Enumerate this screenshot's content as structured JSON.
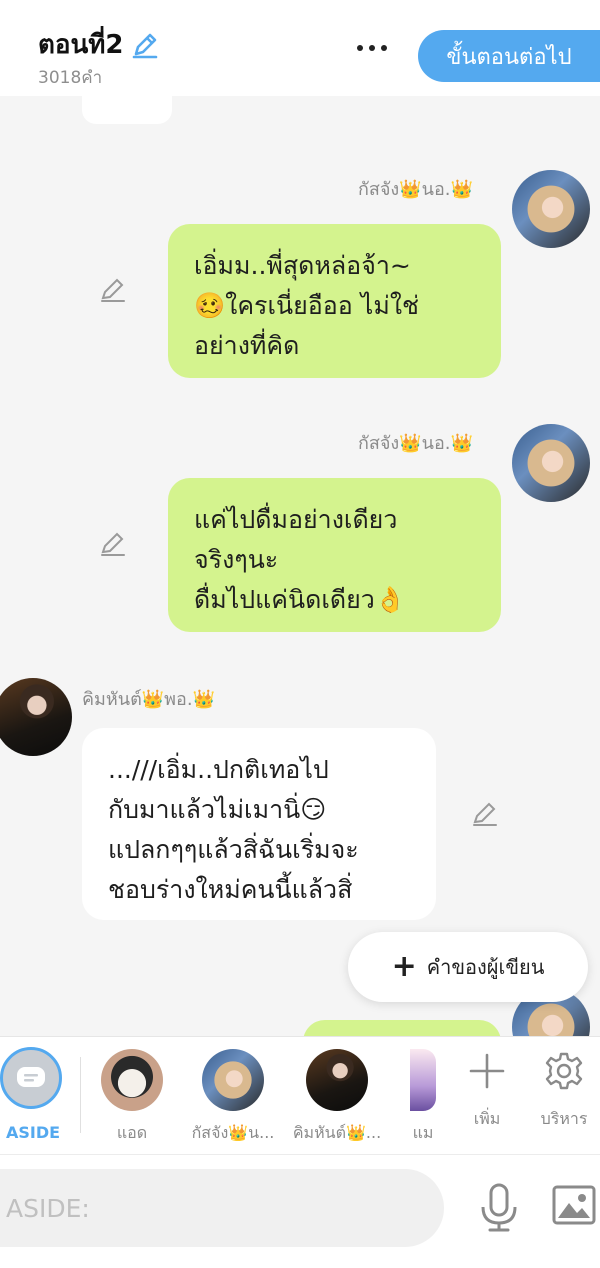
{
  "header": {
    "title": "ตอนที่2",
    "word_count": "3018คำ",
    "next_label": "ขั้นตอนต่อไป"
  },
  "messages": [
    {
      "sender": "กัสจัง👑นอ.👑",
      "side": "right",
      "text": "เอิ่มม..พี่สุดหล่อจ้า~\n🥴ใครเนี่ยอืออ ไม่ใช่\nอย่างที่คิด"
    },
    {
      "sender": "กัสจัง👑นอ.👑",
      "side": "right",
      "text": "แค่ไปดื่มอย่างเดียว\nจริงๆนะ\nดื่มไปแค่นิดเดียว👌"
    },
    {
      "sender": "คิมหันต์👑พอ.👑",
      "side": "left",
      "text": "...///เอิ่ม..ปกติเทอไป\nกับมาแล้วไม่เมานิ่😏\nแปลกๆๆแล้วสิ่ฉันเริ่มจะ\nชอบร่างใหม่คนนี้แล้วสิ่"
    }
  ],
  "writer_button": "คำของผู้เขียน",
  "character_bar": {
    "aside_label": "ASIDE",
    "characters": [
      {
        "name": "แอด"
      },
      {
        "name": "กัสจัง👑น..."
      },
      {
        "name": "คิมหันต์👑..."
      },
      {
        "name": "แม"
      }
    ],
    "add_label": "เพิ่ม",
    "manage_label": "บริหาร"
  },
  "input": {
    "placeholder": "ASIDE:"
  },
  "colors": {
    "accent": "#54a9ef",
    "bubble_green": "#d4f38e",
    "background": "#f5f5f5"
  }
}
